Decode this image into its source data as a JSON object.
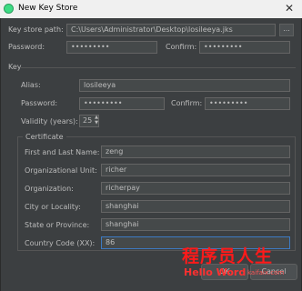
{
  "window": {
    "title": "New Key Store",
    "close_glyph": "✕"
  },
  "keystore": {
    "path_label": "Key store path:",
    "path_value": "C:\\Users\\Administrator\\Desktop\\losileeya.jks",
    "browse_label": "...",
    "password_label": "Password:",
    "password_value": "•••••••••",
    "confirm_label": "Confirm:",
    "confirm_value": "•••••••••"
  },
  "key": {
    "section_label": "Key",
    "alias_label": "Alias:",
    "alias_value": "losileeya",
    "password_label": "Password:",
    "password_value": "•••••••••",
    "confirm_label": "Confirm:",
    "confirm_value": "•••••••••",
    "validity_label": "Validity (years):",
    "validity_value": "25"
  },
  "certificate": {
    "section_label": "Certificate",
    "fields": [
      {
        "label": "First and Last Name:",
        "value": "zeng"
      },
      {
        "label": "Organizational Unit:",
        "value": "richer"
      },
      {
        "label": "Organization:",
        "value": "richerpay"
      },
      {
        "label": "City or Locality:",
        "value": "shanghai"
      },
      {
        "label": "State or Province:",
        "value": "shanghai"
      },
      {
        "label": "Country Code (XX):",
        "value": "86"
      }
    ]
  },
  "buttons": {
    "ok_label": "OK",
    "cancel_label": "Cancel"
  },
  "watermark": {
    "cn_text": "程序员人生",
    "en_text": "Hello Word",
    "site_text": "kaifaix.com"
  },
  "colors": {
    "background": "#3c3f41",
    "field": "#45494a",
    "focus_border": "#3d7ac3",
    "watermark": "#ff1a1a"
  },
  "icons": {
    "app": "android-studio-icon",
    "close": "close-icon"
  }
}
